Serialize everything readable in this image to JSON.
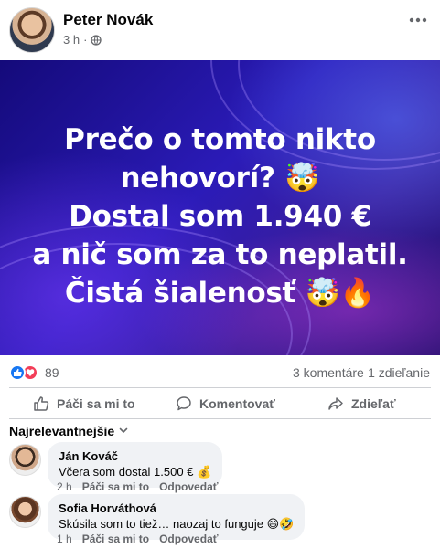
{
  "post": {
    "author": "Peter Novák",
    "time": "3 h",
    "separator": "·",
    "privacy_icon": "globe-icon",
    "more_icon": "more-horizontal-icon"
  },
  "image": {
    "lines": [
      "Prečo o tomto nikto",
      "nehovorí? 🤯",
      "Dostal som 1.940 €",
      "a nič som za to neplatil.",
      "Čistá šialenosť 🤯🔥"
    ],
    "colors": {
      "background": "#2b1bb8",
      "text": "#ffffff"
    }
  },
  "stats": {
    "reaction_icons": [
      "like-icon",
      "love-icon"
    ],
    "reactions": "89",
    "comments": "3 komentáre",
    "shares": "1 zdieľanie"
  },
  "actions": {
    "like": "Páči sa mi to",
    "comment": "Komentovať",
    "share": "Zdieľať"
  },
  "sort": {
    "label": "Najrelevantnejšie"
  },
  "comments": [
    {
      "name": "Ján Kováč",
      "text": "Včera som dostal 1.500 € 💰",
      "time": "2 h",
      "like": "Páči sa mi to",
      "reply": "Odpovedať"
    },
    {
      "name": "Sofia Horváthová",
      "text": "Skúsila som to tiež… naozaj to funguje 😄🤣",
      "time": "1 h",
      "like": "Páči sa mi to",
      "reply": "Odpovedať"
    }
  ],
  "theme": {
    "accent": "#1877f2",
    "love": "#f33e58",
    "muted_text": "#65676b",
    "bubble": "#f0f2f5"
  }
}
